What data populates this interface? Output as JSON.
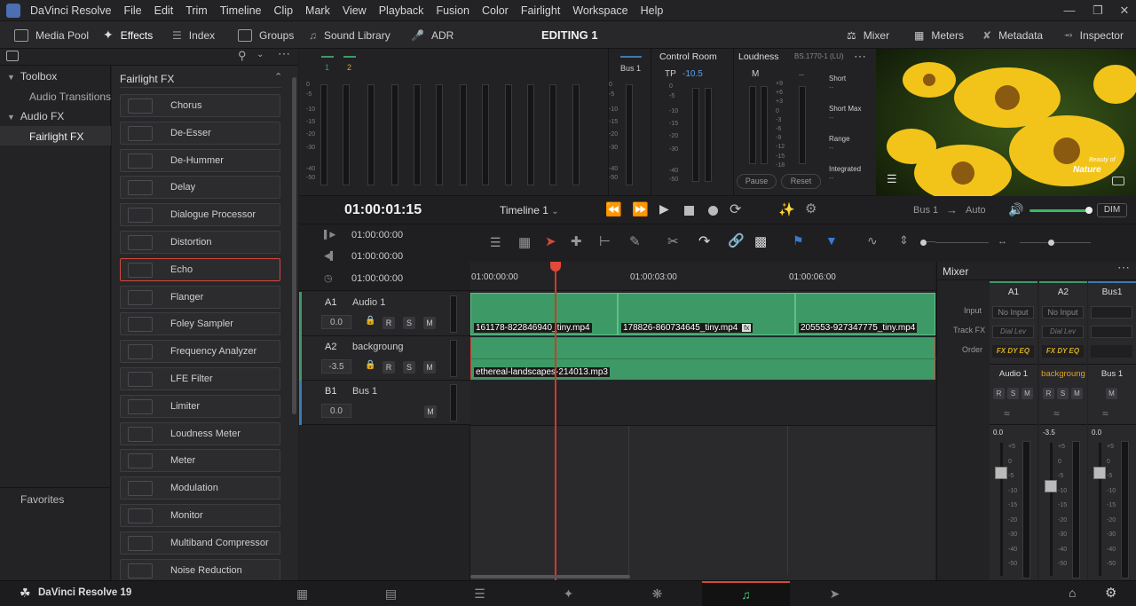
{
  "title_bar": {
    "app": "DaVinci Resolve",
    "menu": [
      "File",
      "Edit",
      "Trim",
      "Timeline",
      "Clip",
      "Mark",
      "View",
      "Playback",
      "Fusion",
      "Color",
      "Fairlight",
      "Workspace",
      "Help"
    ]
  },
  "toolbar": {
    "left": [
      "Media Pool",
      "Effects",
      "Index",
      "Groups",
      "Sound Library",
      "ADR"
    ],
    "center_title": "EDITING 1",
    "right": [
      "Mixer",
      "Meters",
      "Metadata",
      "Inspector"
    ]
  },
  "toolbox": {
    "items": [
      "Toolbox",
      "Audio Transitions",
      "Audio FX",
      "Fairlight FX"
    ],
    "favorites": "Favorites"
  },
  "fx_panel": {
    "title": "Fairlight FX",
    "items": [
      "Chorus",
      "De-Esser",
      "De-Hummer",
      "Delay",
      "Dialogue Processor",
      "Distortion",
      "Echo",
      "Flanger",
      "Foley Sampler",
      "Frequency Analyzer",
      "LFE Filter",
      "Limiter",
      "Loudness Meter",
      "Meter",
      "Modulation",
      "Monitor",
      "Multiband Compressor",
      "Noise Reduction"
    ],
    "selected": "Echo"
  },
  "meters": {
    "track_labels": [
      "1",
      "2"
    ],
    "scale": [
      "0",
      "-5",
      "-10",
      "-15",
      "-20",
      "-30",
      "-40",
      "-50"
    ],
    "bus_label": "Bus 1",
    "control_room": {
      "title": "Control Room",
      "tp_label": "TP",
      "tp_value": "-10.5"
    },
    "loudness": {
      "title": "Loudness",
      "standard": "BS.1770-1 (LU)",
      "m_label": "M",
      "lu_scale": [
        "+9",
        "+6",
        "+3",
        "0",
        "-3",
        "-6",
        "-9",
        "-12",
        "-15",
        "-18"
      ],
      "metrics": [
        "Short",
        "Short Max",
        "Range",
        "Integrated"
      ],
      "pause": "Pause",
      "reset": "Reset",
      "placeholder": "--"
    }
  },
  "viewer": {
    "overlay_line1": "Beauty of",
    "overlay_line2": "Nature"
  },
  "transport": {
    "timecode": "01:00:01:15",
    "timeline_name": "Timeline 1",
    "output": "Bus 1",
    "arrow": "→",
    "mode": "Auto",
    "dim": "DIM"
  },
  "timecodes": [
    "01:00:00:00",
    "01:00:00:00",
    "01:00:00:00"
  ],
  "ruler": [
    "01:00:00:00",
    "01:00:03:00",
    "01:00:06:00"
  ],
  "tracks": [
    {
      "id": "A1",
      "name": "Audio 1",
      "vol": "0.0",
      "buttons": [
        "R",
        "S",
        "M"
      ]
    },
    {
      "id": "A2",
      "name": "backgroung",
      "vol": "-3.5",
      "buttons": [
        "R",
        "S",
        "M"
      ]
    },
    {
      "id": "B1",
      "name": "Bus 1",
      "vol": "0.0",
      "buttons": [
        "M"
      ]
    }
  ],
  "clips_a1": [
    "161178-822846940_tiny.mp4",
    "178826-860734645_tiny.mp4",
    "205553-927347775_tiny.mp4"
  ],
  "clip_a2": "ethereal-landscapes-214013.mp3",
  "fx_badge": "fx",
  "mixer": {
    "title": "Mixer",
    "row_labels": [
      "Input",
      "Track FX",
      "Order"
    ],
    "columns": [
      {
        "id": "A1",
        "input": "No Input",
        "fx": "Dial Lev",
        "order": "FX DY EQ",
        "name": "Audio 1",
        "buttons": [
          "R",
          "S",
          "M"
        ],
        "value": "0.0"
      },
      {
        "id": "A2",
        "input": "No Input",
        "fx": "Dial Lev",
        "order": "FX DY EQ",
        "name": "backgroung",
        "buttons": [
          "R",
          "S",
          "M"
        ],
        "value": "-3.5"
      },
      {
        "id": "Bus1",
        "input": "",
        "fx": "",
        "order": "",
        "name": "Bus 1",
        "buttons": [
          "M"
        ],
        "value": "0.0"
      }
    ],
    "fader_scale": [
      "+5",
      "0",
      "-5",
      "-10",
      "-15",
      "-20",
      "-30",
      "-40",
      "-50"
    ]
  },
  "bottom_bar": {
    "product": "DaVinci Resolve 19"
  }
}
